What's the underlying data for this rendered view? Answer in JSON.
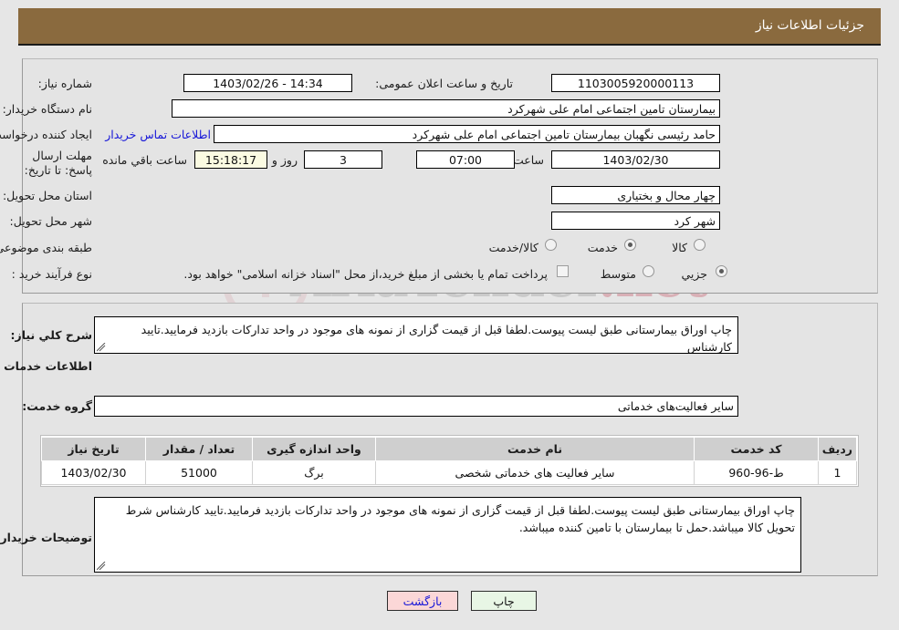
{
  "header": {
    "title": "جزئیات اطلاعات نیاز"
  },
  "watermark": {
    "text": "AriaTender",
    "suffix": ".net",
    "shield_icon": "shield-icon"
  },
  "top_panel": {
    "need_number_label": "شماره نیاز:",
    "need_number_value": "1103005920000113",
    "announce_datetime_label": "تاریخ و ساعت اعلان عمومی:",
    "announce_datetime_value": "1403/02/26 - 14:34",
    "buyer_org_label": "نام دستگاه خریدار:",
    "buyer_org_value": "بیمارستان تامین اجتماعی امام علی شهرکرد",
    "requester_label": "ایجاد کننده درخواست:",
    "requester_value": "حامد رئیسی نگهبان بیمارستان تامین اجتماعی امام علی شهرکرد",
    "contact_link": "اطلاعات تماس خریدار",
    "deadline_label": "مهلت ارسال پاسخ: تا تاریخ:",
    "deadline_date": "1403/02/30",
    "hour_label": "ساعت",
    "deadline_time": "07:00",
    "remaining_days": "3",
    "days_and_label": "روز و",
    "remaining_time": "15:18:17",
    "remaining_suffix": "ساعت باقي مانده",
    "province_label": "استان محل تحویل:",
    "province_value": "چهار محال و بختیاری",
    "city_label": "شهر محل تحویل:",
    "city_value": "شهر کرد",
    "category_label": "طبقه بندی موضوعی:",
    "category_options": [
      {
        "label": "کالا",
        "selected": false
      },
      {
        "label": "خدمت",
        "selected": true
      },
      {
        "label": "کالا/خدمت",
        "selected": false
      }
    ],
    "process_label": "نوع فرآیند خرید :",
    "process_options": [
      {
        "label": "جزیي",
        "selected": true
      },
      {
        "label": "متوسط",
        "selected": false
      }
    ],
    "treasury_checkbox_label": "پرداخت تمام یا بخشی از مبلغ خرید،از محل \"اسناد خزانه اسلامی\" خواهد بود.",
    "treasury_checked": false
  },
  "mid_panel": {
    "overall_desc_label": "شرح کلي نیاز:",
    "overall_desc_value": "چاپ اوراق بیمارستانی طبق لیست پیوست.لطفا قبل از قیمت گزاری از نمونه های موجود در واحد تدارکات بازدید فرمایید.تایید کارشناس",
    "services_info_title": "اطلاعات خدمات مورد نیاز",
    "service_group_label": "گروه خدمت:",
    "service_group_value": "سایر فعالیت‌های خدماتی",
    "buyer_notes_label": "توضیحات خریدار:",
    "buyer_notes_value": "چاپ اوراق بیمارستانی طبق لیست پیوست.لطفا قبل از قیمت گزاری از نمونه های موجود در واحد تدارکات بازدید فرمایید.تایید کارشناس شرط تحویل کالا میباشد.حمل تا بیمارستان با تامین کننده میباشد."
  },
  "table": {
    "columns": [
      "ردیف",
      "کد خدمت",
      "نام خدمت",
      "واحد اندازه گیری",
      "تعداد / مقدار",
      "تاریخ نیاز"
    ],
    "rows": [
      {
        "row_no": "1",
        "service_code": "ط-96-960",
        "service_name": "سایر فعالیت های خدماتی شخصی",
        "unit": "برگ",
        "quantity": "51000",
        "need_date": "1403/02/30"
      }
    ]
  },
  "footer": {
    "print_label": "چاپ",
    "back_label": "بازگشت"
  },
  "colors": {
    "header_bar": "#8a6a3e",
    "page_bg": "#e6e6e6",
    "panel_bg": "#e4e4e4",
    "link": "#1616d8",
    "table_header": "#cfcfcf",
    "print_btn": "#e8f6e5",
    "back_btn": "#fbd7d7",
    "timer_field": "#fbfbe2"
  }
}
